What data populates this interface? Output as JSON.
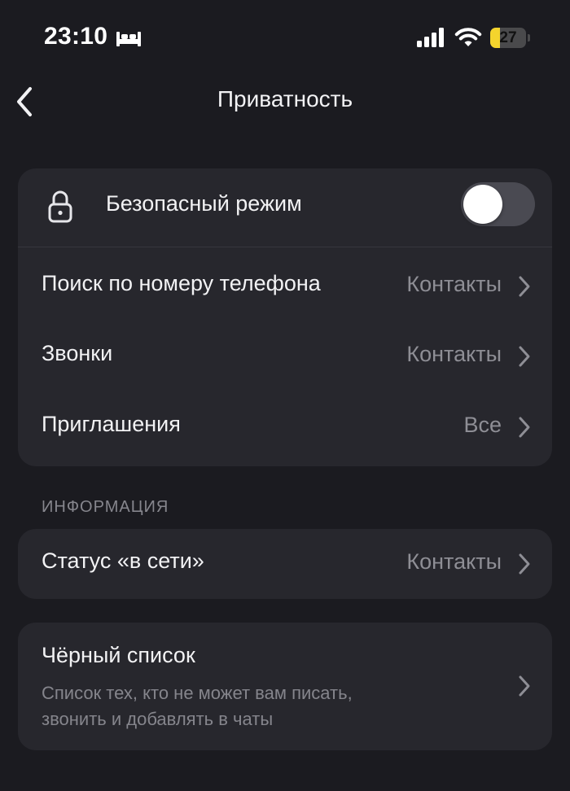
{
  "status_bar": {
    "time": "23:10",
    "battery_level": "27",
    "battery_fraction": 0.27
  },
  "nav": {
    "title": "Приватность"
  },
  "main_card": {
    "safe_mode": {
      "label": "Безопасный режим",
      "enabled": false
    },
    "rows": [
      {
        "label": "Поиск по номеру телефона",
        "value": "Контакты"
      },
      {
        "label": "Звонки",
        "value": "Контакты"
      },
      {
        "label": "Приглашения",
        "value": "Все"
      }
    ]
  },
  "information_section": {
    "header": "ИНФОРМАЦИЯ",
    "online_status": {
      "label": "Статус «в сети»",
      "value": "Контакты"
    }
  },
  "blacklist": {
    "title": "Чёрный список",
    "description_line1": "Список тех, кто не может вам писать,",
    "description_line2": "звонить и добавлять в чаты"
  },
  "icons": {
    "status_bar": [
      "bed-icon",
      "signal-icon",
      "wifi-icon",
      "battery-icon"
    ],
    "nav": "chevron-left-icon",
    "safe_mode": "lock-icon",
    "rows": "chevron-right-icon"
  },
  "colors": {
    "background": "#1b1b20",
    "card": "#27272d",
    "text": "#f2f2f4",
    "secondary_text": "#8e8e95",
    "battery_accent": "#f4d42d",
    "toggle_off": "#4a4a52"
  }
}
